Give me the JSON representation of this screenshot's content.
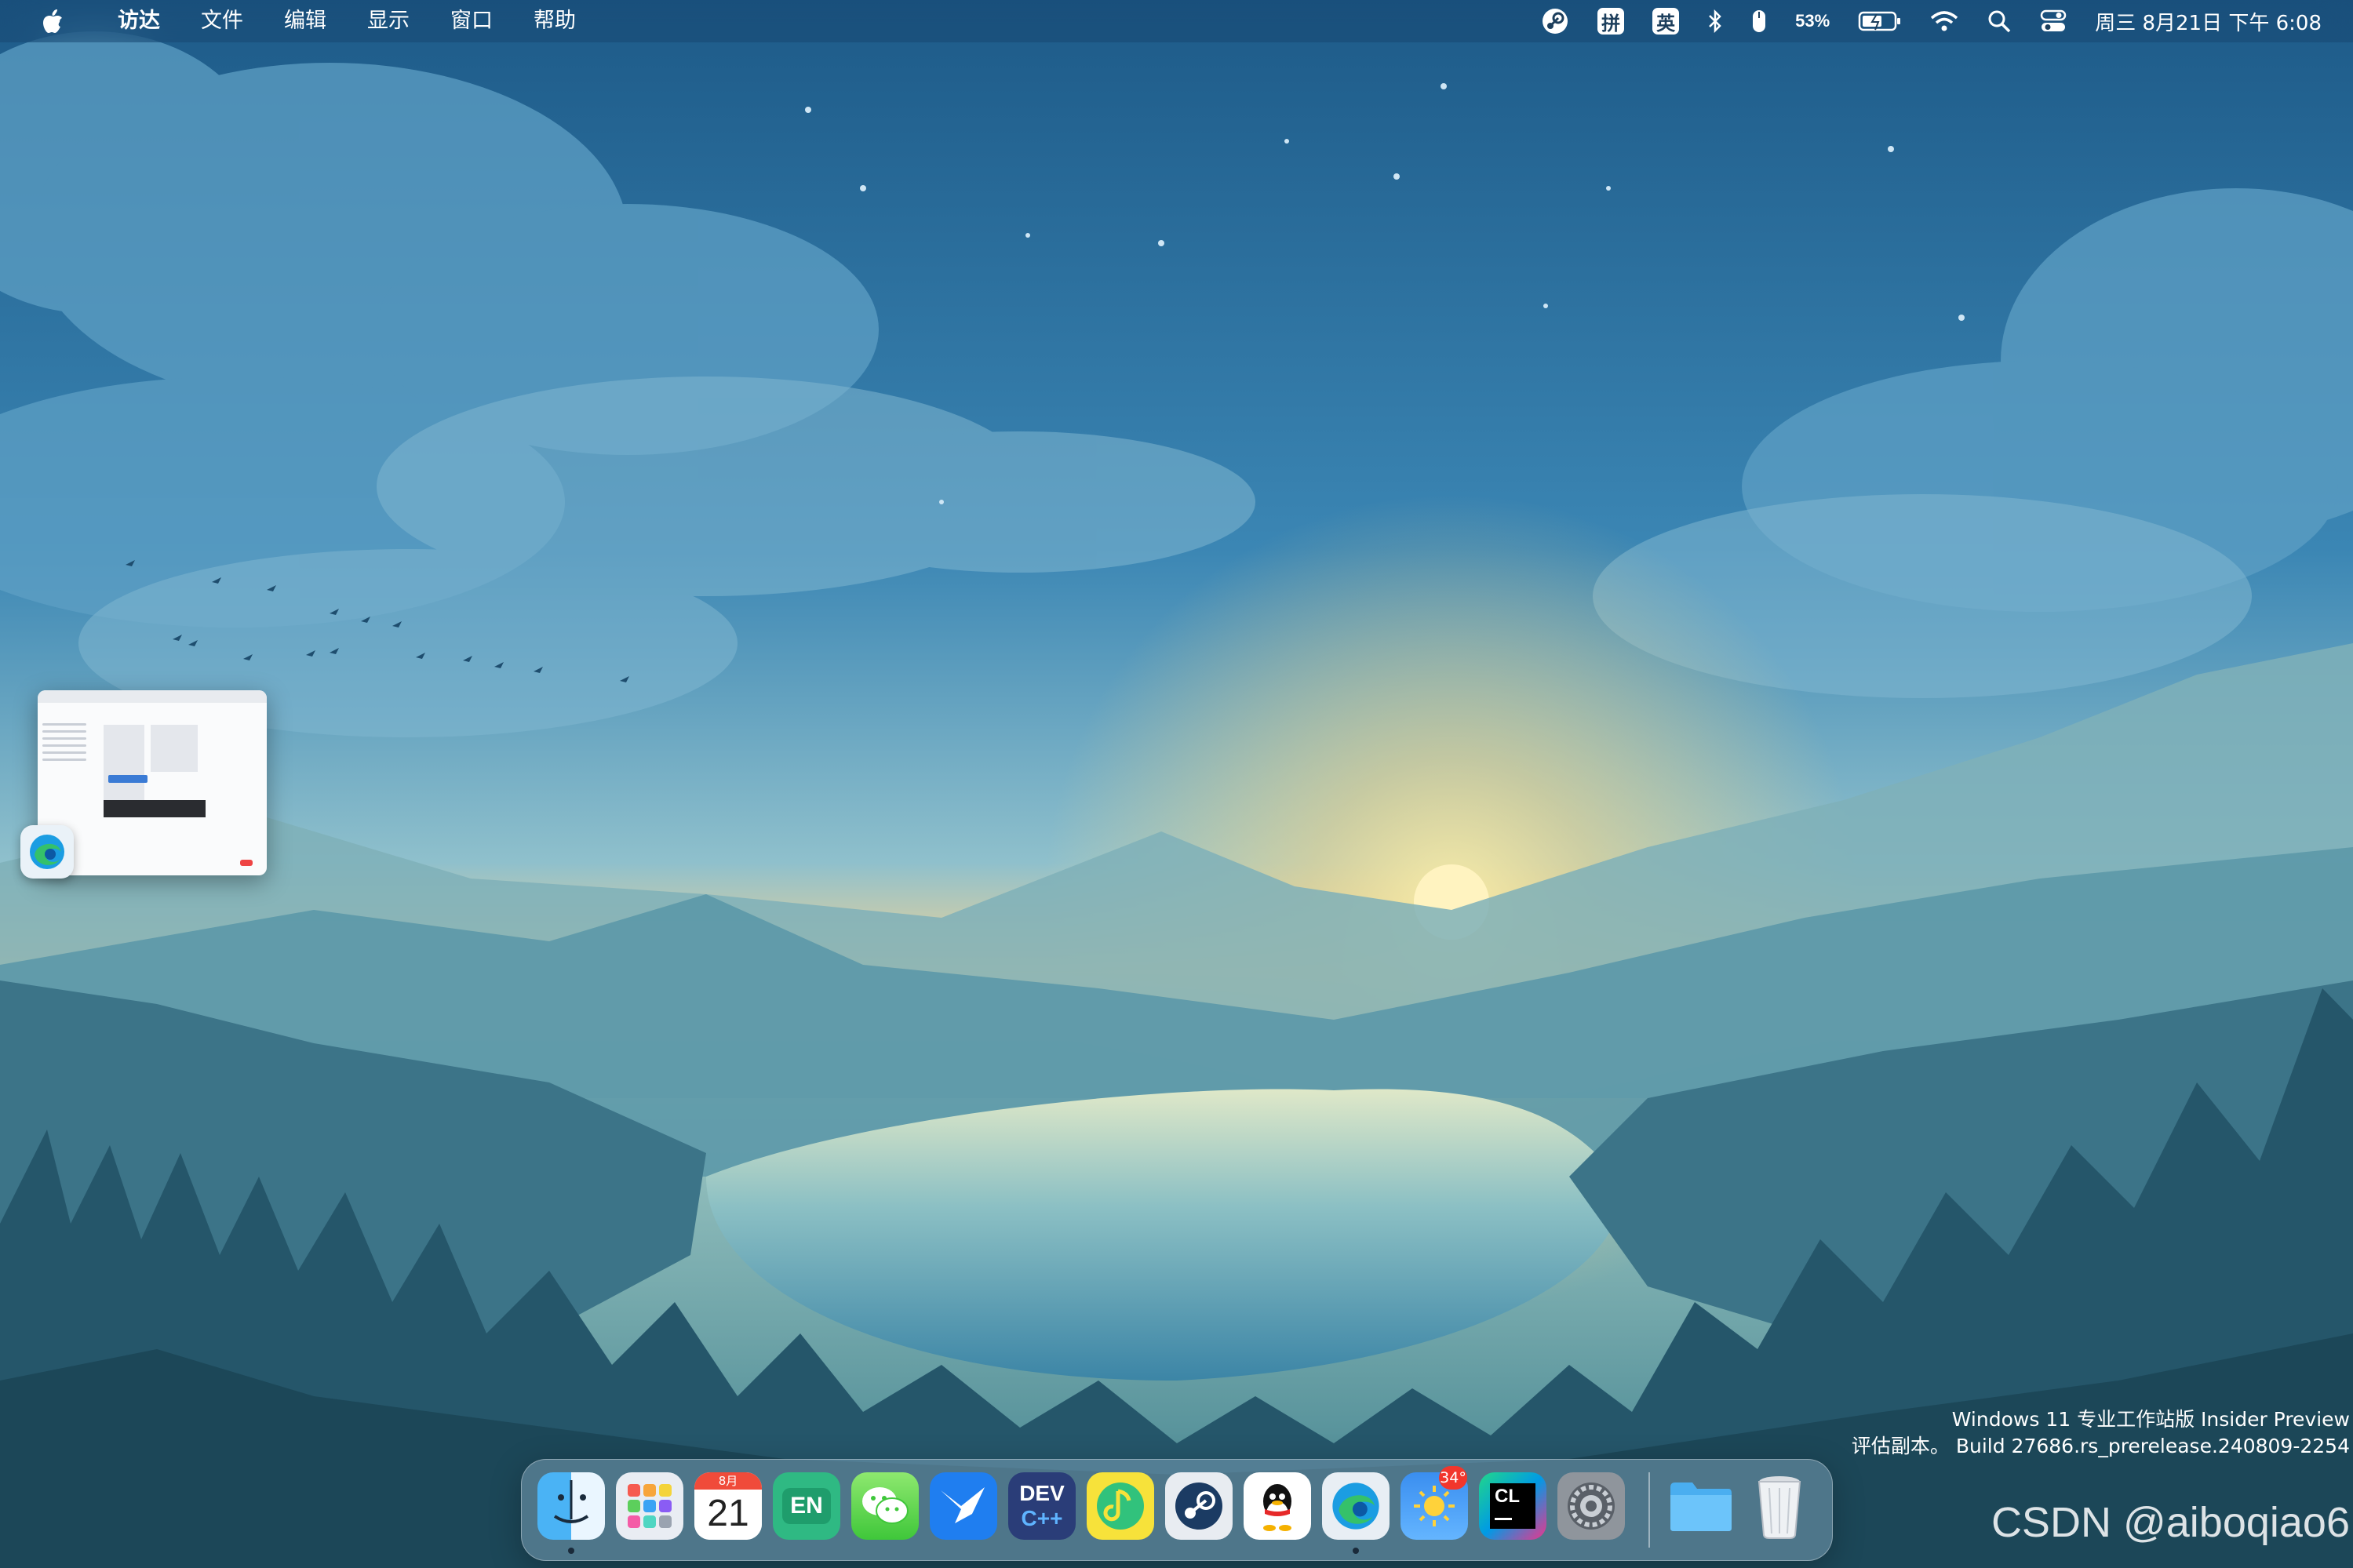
{
  "menubar": {
    "apple_icon": "apple-logo",
    "menus": [
      "访达",
      "文件",
      "编辑",
      "显示",
      "窗口",
      "帮助"
    ],
    "tray": {
      "ime_pinyin": "拼",
      "ime_lang": "英",
      "battery_percent": "53%",
      "clock": "周三 8月21日 下午 6:08"
    }
  },
  "desktop": {
    "watermark_line1": "Windows 11 专业工作站版 Insider Preview",
    "watermark_line2": "评估副本。 Build 27686.rs_prerelease.240809-2254",
    "csdn_watermark": "CSDN @aiboqiao6"
  },
  "dock": {
    "apps": [
      {
        "name": "finder",
        "icon": "finder-icon",
        "running": true
      },
      {
        "name": "launchpad",
        "icon": "launchpad-icon",
        "running": false
      },
      {
        "name": "calendar",
        "icon": "calendar-icon",
        "month": "8月",
        "day": "21",
        "running": false
      },
      {
        "name": "eudic",
        "icon": "en-dictionary-icon",
        "label": "EN",
        "running": false
      },
      {
        "name": "wechat",
        "icon": "wechat-icon",
        "running": false
      },
      {
        "name": "feishu-bird",
        "icon": "bird-icon",
        "running": false
      },
      {
        "name": "devcpp",
        "icon": "devcpp-icon",
        "label_top": "DEV",
        "label_bottom": "C++",
        "running": false
      },
      {
        "name": "qqmusic",
        "icon": "music-note-icon",
        "running": false
      },
      {
        "name": "steam",
        "icon": "steam-icon",
        "running": false
      },
      {
        "name": "qq",
        "icon": "penguin-icon",
        "running": false
      },
      {
        "name": "edge",
        "icon": "edge-icon",
        "running": true
      },
      {
        "name": "weather",
        "icon": "weather-sun-icon",
        "badge": "34°",
        "running": false
      },
      {
        "name": "clion",
        "icon": "clion-icon",
        "label": "CL",
        "running": false
      },
      {
        "name": "system-settings",
        "icon": "gear-icon",
        "running": false
      },
      {
        "name": "downloads-folder",
        "icon": "folder-icon",
        "running": false
      },
      {
        "name": "trash",
        "icon": "trash-icon",
        "running": false
      }
    ]
  },
  "colors": {
    "sky_top": "#1f5f8e",
    "sun": "#f6e7a8",
    "accent_red": "#f2362c"
  }
}
